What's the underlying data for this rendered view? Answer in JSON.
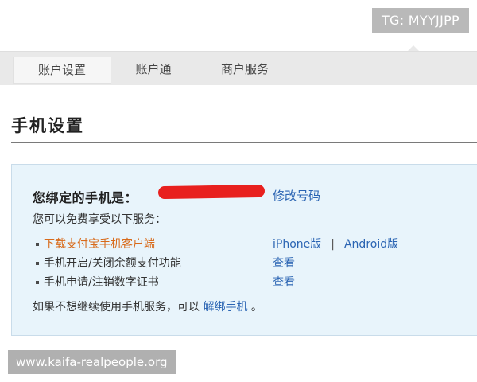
{
  "watermarks": {
    "telegram": "TG: MYYJJPP",
    "site": "www.kaifa-realpeople.org"
  },
  "tabs": [
    {
      "label": "账户设置",
      "active": true
    },
    {
      "label": "账户通",
      "active": false
    },
    {
      "label": "商户服务",
      "active": false
    }
  ],
  "page": {
    "title": "手机设置"
  },
  "panel": {
    "bound_label": "您绑定的手机是：",
    "modify_link": "修改号码",
    "services_intro": "您可以免费享受以下服务：",
    "services": [
      {
        "text": "下载支付宝手机客户端",
        "links": [
          "iPhone版",
          "Android版"
        ],
        "separator": "|"
      },
      {
        "text": "手机开启/关闭余额支付功能",
        "links": [
          "查看"
        ]
      },
      {
        "text": "手机申请/注销数字证书",
        "links": [
          "查看"
        ]
      }
    ],
    "footer_prefix": "如果不想继续使用手机服务，可以",
    "footer_link": "解绑手机",
    "footer_suffix": "。"
  },
  "colors": {
    "link": "#2a64b3",
    "highlight": "#d86a1a",
    "redaction": "#e8201e",
    "panel_bg": "#e8f4fb"
  }
}
